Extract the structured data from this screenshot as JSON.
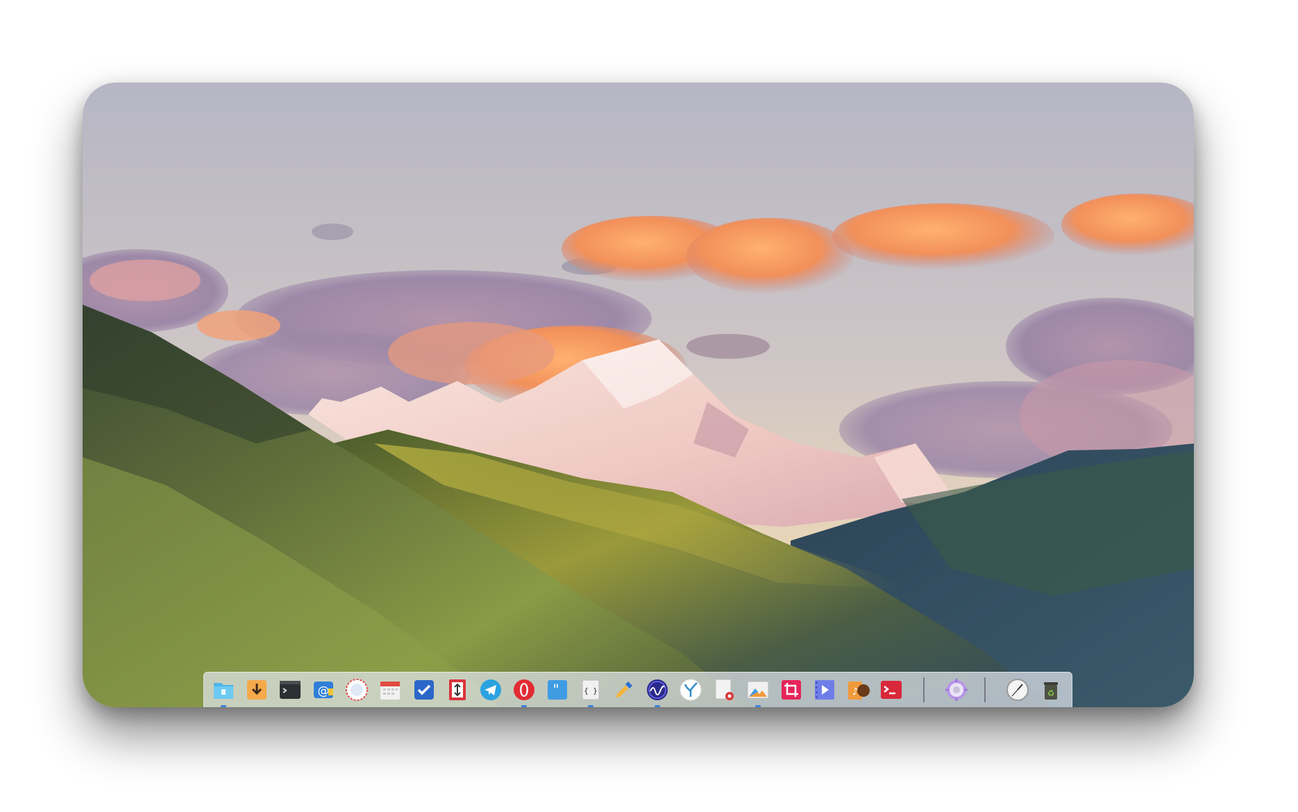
{
  "desktop": {
    "wallpaper": "mountain-sunset-landscape",
    "palette": {
      "sky_top": "#b3b2bf",
      "sky_bottom": "#e8d3b6",
      "cloud_orange": "#f59a5e",
      "cloud_purple": "#9f8aa8",
      "snow": "#f4dcd6",
      "hill_green": "#6f7f3c",
      "ridge_blue": "#2f4a6c"
    }
  },
  "dock": {
    "apps": [
      {
        "icon": "file-manager-icon",
        "running": true
      },
      {
        "icon": "downloader-icon",
        "running": false
      },
      {
        "icon": "terminal-icon",
        "running": false
      },
      {
        "icon": "mail-icon",
        "running": false
      },
      {
        "icon": "browser-icon",
        "running": false
      },
      {
        "icon": "calendar-icon",
        "running": false
      },
      {
        "icon": "todo-icon",
        "running": false
      },
      {
        "icon": "transfer-icon",
        "running": false
      },
      {
        "icon": "telegram-icon",
        "running": false
      },
      {
        "icon": "opera-icon",
        "running": true
      },
      {
        "icon": "quote-icon",
        "running": false
      },
      {
        "icon": "code-editor-icon",
        "running": true
      },
      {
        "icon": "color-picker-icon",
        "running": false
      },
      {
        "icon": "audio-editor-icon",
        "running": true
      },
      {
        "icon": "coral-app-icon",
        "running": false
      },
      {
        "icon": "document-viewer-icon",
        "running": false
      },
      {
        "icon": "image-viewer-icon",
        "running": true
      },
      {
        "icon": "crop-tool-icon",
        "running": false
      },
      {
        "icon": "video-player-icon",
        "running": false
      },
      {
        "icon": "music-player-icon",
        "running": false
      },
      {
        "icon": "remote-terminal-icon",
        "running": false
      }
    ],
    "system": [
      {
        "icon": "settings-icon"
      }
    ],
    "extras": [
      {
        "icon": "clock-icon"
      },
      {
        "icon": "trash-icon"
      }
    ]
  }
}
